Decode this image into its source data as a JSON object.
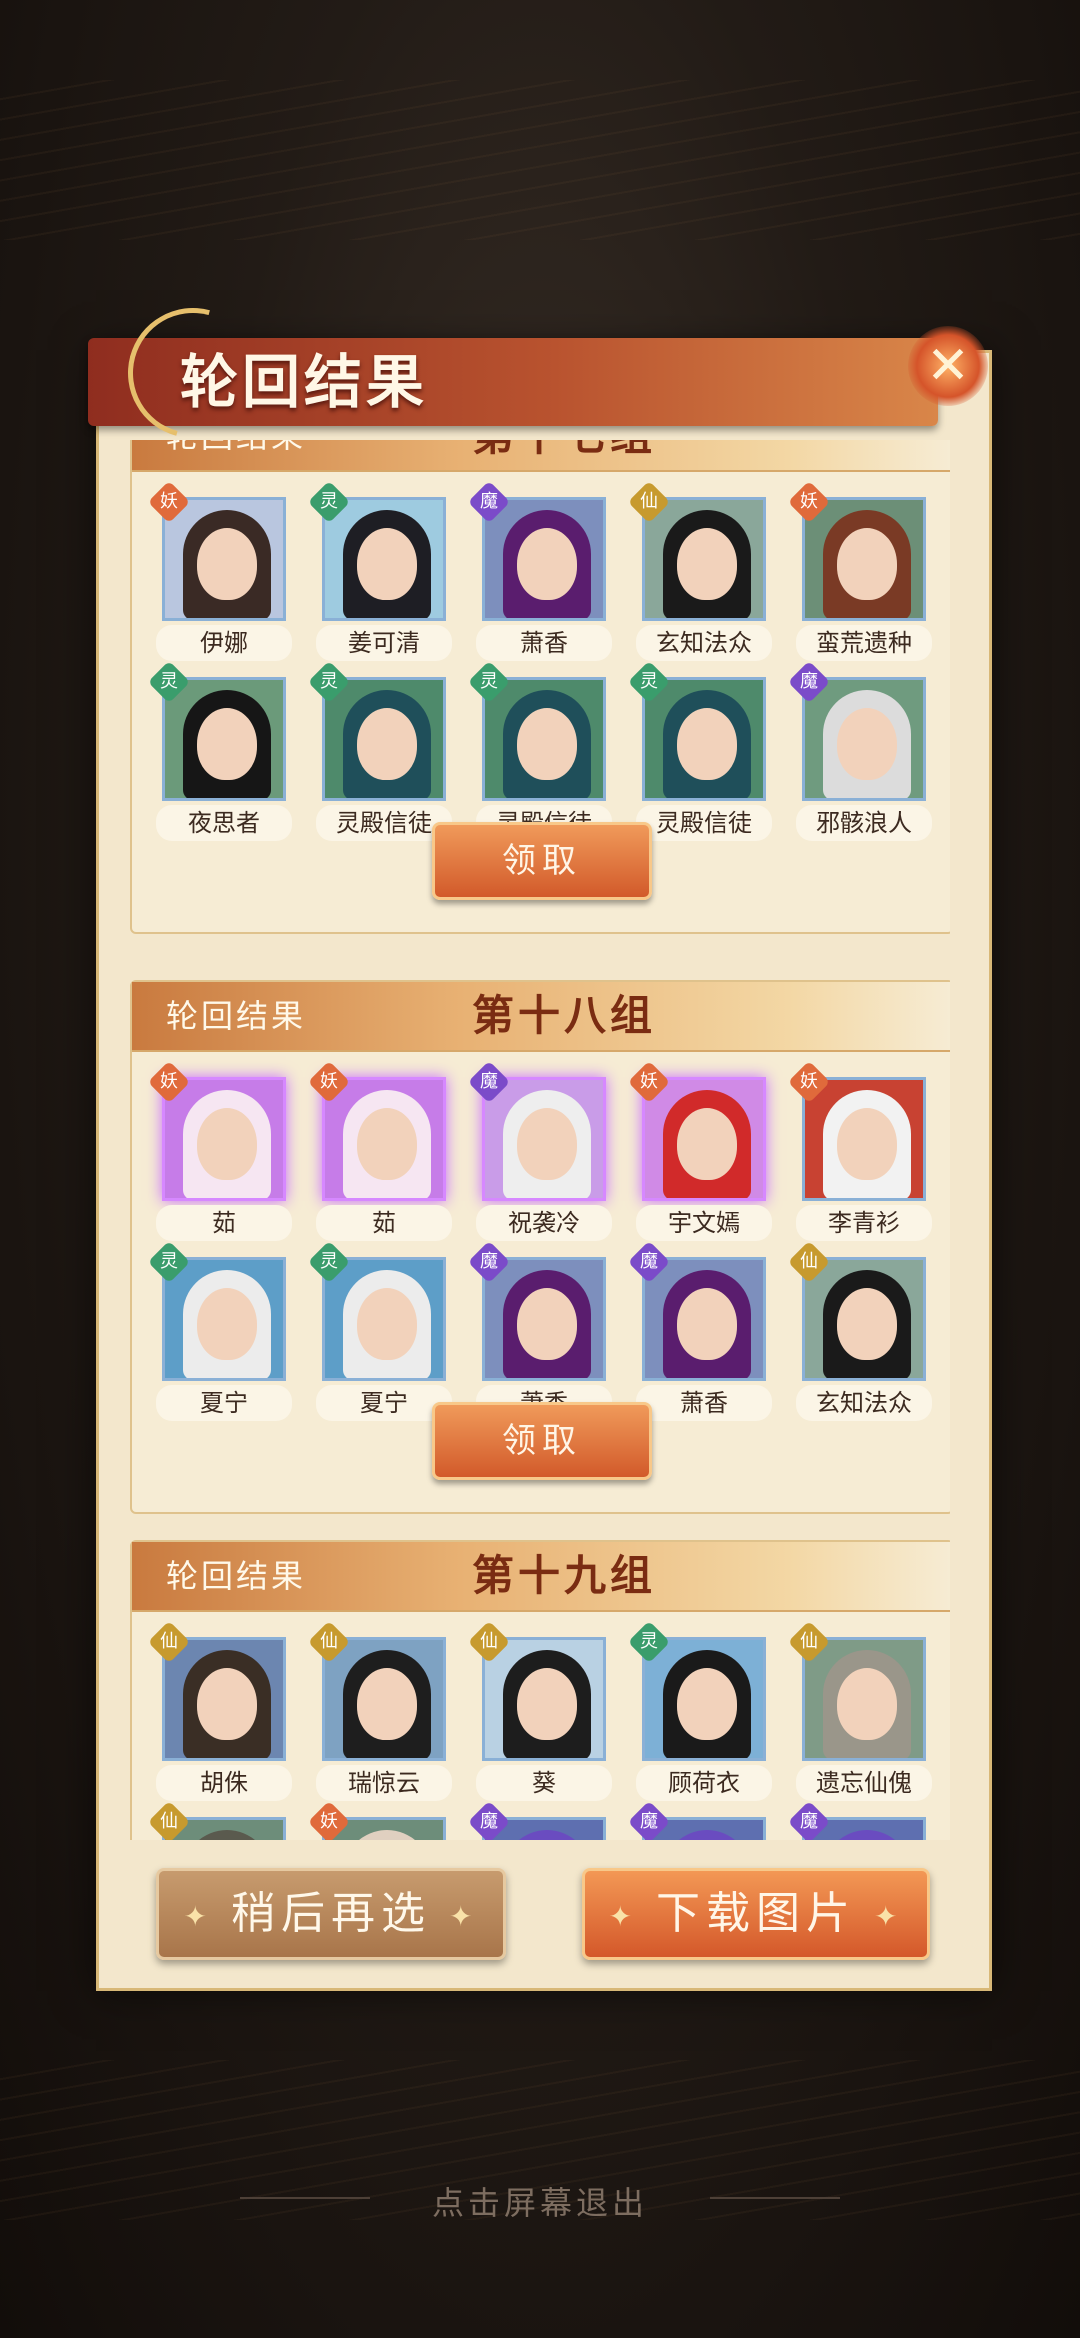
{
  "title": "轮回结果",
  "close_icon": "✕",
  "groups": [
    {
      "label": "轮回结果",
      "number": "第十七组",
      "claim": "领取",
      "cards": [
        {
          "name": "伊娜",
          "badge": "妖",
          "badge_type": "yao",
          "hair": "#3a2a25",
          "bg": "#b9c6df"
        },
        {
          "name": "姜可清",
          "badge": "灵",
          "badge_type": "ling",
          "hair": "#1e1e24",
          "bg": "#9ecbe0"
        },
        {
          "name": "萧香",
          "badge": "魔",
          "badge_type": "mo",
          "hair": "#5a1d6e",
          "bg": "#7d8fbd"
        },
        {
          "name": "玄知法众",
          "badge": "仙",
          "badge_type": "xian",
          "hair": "#1a1a1a",
          "bg": "#8aa79a"
        },
        {
          "name": "蛮荒遗种",
          "badge": "妖",
          "badge_type": "yao",
          "hair": "#7a3a25",
          "bg": "#6c8f77"
        },
        {
          "name": "夜思者",
          "badge": "灵",
          "badge_type": "ling",
          "hair": "#161616",
          "bg": "#6b9a7a"
        },
        {
          "name": "灵殿信徒",
          "badge": "灵",
          "badge_type": "ling",
          "hair": "#1f4f5a",
          "bg": "#4e8a6b"
        },
        {
          "name": "灵殿信徒",
          "badge": "灵",
          "badge_type": "ling",
          "hair": "#1f4f5a",
          "bg": "#4e8a6b"
        },
        {
          "name": "灵殿信徒",
          "badge": "灵",
          "badge_type": "ling",
          "hair": "#1f4f5a",
          "bg": "#4e8a6b"
        },
        {
          "name": "邪骸浪人",
          "badge": "魔",
          "badge_type": "mo",
          "hair": "#dcdcdc",
          "bg": "#6f9b7f"
        }
      ]
    },
    {
      "label": "轮回结果",
      "number": "第十八组",
      "claim": "领取",
      "cards": [
        {
          "name": "茹",
          "badge": "妖",
          "badge_type": "yao",
          "hair": "#f6e6f2",
          "bg": "#c67ce8",
          "frame": "purple"
        },
        {
          "name": "茹",
          "badge": "妖",
          "badge_type": "yao",
          "hair": "#f6e6f2",
          "bg": "#c67ce8",
          "frame": "purple"
        },
        {
          "name": "祝袭冷",
          "badge": "魔",
          "badge_type": "mo",
          "hair": "#eeeeee",
          "bg": "#c99ce8",
          "frame": "purple"
        },
        {
          "name": "宇文嫣",
          "badge": "妖",
          "badge_type": "yao",
          "hair": "#d12a2a",
          "bg": "#d08ae6",
          "frame": "purple"
        },
        {
          "name": "李青衫",
          "badge": "妖",
          "badge_type": "yao",
          "hair": "#f2f2f2",
          "bg": "#c84232"
        },
        {
          "name": "夏宁",
          "badge": "灵",
          "badge_type": "ling",
          "hair": "#ececec",
          "bg": "#5d9ec8"
        },
        {
          "name": "夏宁",
          "badge": "灵",
          "badge_type": "ling",
          "hair": "#ececec",
          "bg": "#5d9ec8"
        },
        {
          "name": "萧香",
          "badge": "魔",
          "badge_type": "mo",
          "hair": "#5a1d6e",
          "bg": "#7d8fbd"
        },
        {
          "name": "萧香",
          "badge": "魔",
          "badge_type": "mo",
          "hair": "#5a1d6e",
          "bg": "#7d8fbd"
        },
        {
          "name": "玄知法众",
          "badge": "仙",
          "badge_type": "xian",
          "hair": "#1a1a1a",
          "bg": "#8aa79a"
        }
      ]
    },
    {
      "label": "轮回结果",
      "number": "第十九组",
      "claim": "",
      "cards": [
        {
          "name": "胡侏",
          "badge": "仙",
          "badge_type": "xian",
          "hair": "#3a2e25",
          "bg": "#6c86b0"
        },
        {
          "name": "瑞惊云",
          "badge": "仙",
          "badge_type": "xian",
          "hair": "#1e1e1e",
          "bg": "#7ea2c2"
        },
        {
          "name": "葵",
          "badge": "仙",
          "badge_type": "xian",
          "hair": "#1d1d1d",
          "bg": "#b9d1e3"
        },
        {
          "name": "顾荷衣",
          "badge": "灵",
          "badge_type": "ling",
          "hair": "#1a1a1a",
          "bg": "#7db0d6"
        },
        {
          "name": "遗忘仙傀",
          "badge": "仙",
          "badge_type": "xian",
          "hair": "#9a968a",
          "bg": "#7f9b87"
        },
        {
          "name": "",
          "badge": "仙",
          "badge_type": "xian",
          "hair": "#5a5a4e",
          "bg": "#6d8d7a"
        },
        {
          "name": "",
          "badge": "妖",
          "badge_type": "yao",
          "hair": "#e0d0c0",
          "bg": "#6d8d7a"
        },
        {
          "name": "",
          "badge": "魔",
          "badge_type": "mo",
          "hair": "#6a4cc0",
          "bg": "#5e6fb0"
        },
        {
          "name": "",
          "badge": "魔",
          "badge_type": "mo",
          "hair": "#6a4cc0",
          "bg": "#5e6fb0"
        },
        {
          "name": "",
          "badge": "魔",
          "badge_type": "mo",
          "hair": "#6a4cc0",
          "bg": "#5e6fb0"
        }
      ]
    }
  ],
  "buttons": {
    "later": "稍后再选",
    "download": "下载图片"
  },
  "exit_hint": "点击屏幕退出"
}
